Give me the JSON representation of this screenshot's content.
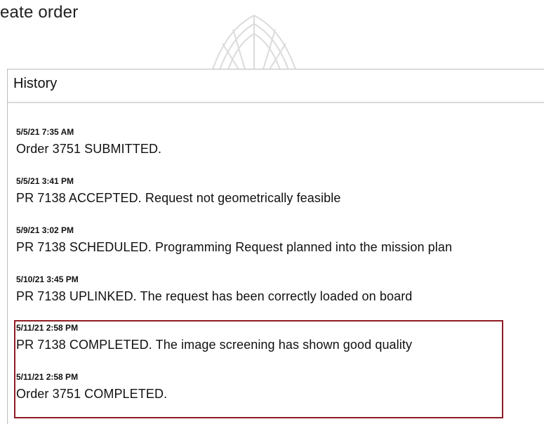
{
  "header": {
    "title_fragment": "eate order"
  },
  "history": {
    "title": "History",
    "entries": [
      {
        "time": "5/5/21 7:35 AM",
        "message": "Order 3751 SUBMITTED."
      },
      {
        "time": "5/5/21 3:41 PM",
        "message": "PR 7138 ACCEPTED. Request not geometrically feasible"
      },
      {
        "time": "5/9/21 3:02 PM",
        "message": "PR 7138 SCHEDULED. Programming Request planned into the mission plan"
      },
      {
        "time": "5/10/21 3:45 PM",
        "message": "PR 7138 UPLINKED. The request has been correctly loaded on board"
      },
      {
        "time": "5/11/21 2:58 PM",
        "message": "PR 7138 COMPLETED. The image screening has shown good quality"
      },
      {
        "time": "5/11/21 2:58 PM",
        "message": "Order 3751 COMPLETED."
      }
    ]
  },
  "colors": {
    "highlight_border": "#8e1c24",
    "panel_border": "#bdbdbd"
  }
}
